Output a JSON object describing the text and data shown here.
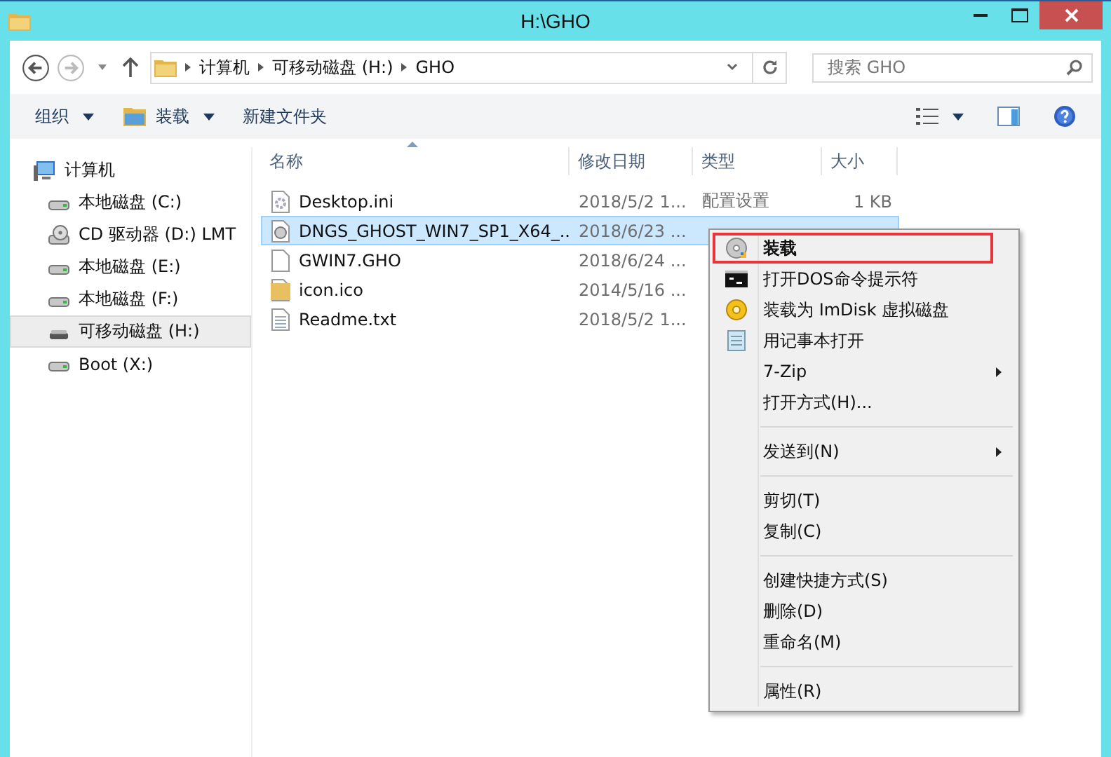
{
  "window": {
    "title": "H:\\GHO"
  },
  "address": {
    "crumbs": [
      "计算机",
      "可移动磁盘 (H:)",
      "GHO"
    ]
  },
  "search": {
    "placeholder": "搜索 GHO"
  },
  "toolbar": {
    "buttons": [
      {
        "label": "组织",
        "dropdown": true
      },
      {
        "label": "装载",
        "dropdown": true
      },
      {
        "label": "新建文件夹",
        "dropdown": false
      }
    ]
  },
  "sidebar": {
    "items": [
      {
        "label": "计算机",
        "kind": "computer",
        "selected": false,
        "children": [
          {
            "label": "本地磁盘 (C:)",
            "kind": "disk",
            "selected": false
          },
          {
            "label": "CD 驱动器 (D:) LMT",
            "kind": "cd",
            "selected": false
          },
          {
            "label": "本地磁盘 (E:)",
            "kind": "disk",
            "selected": false
          },
          {
            "label": "本地磁盘 (F:)",
            "kind": "disk",
            "selected": false
          },
          {
            "label": "可移动磁盘 (H:)",
            "kind": "usb",
            "selected": true
          },
          {
            "label": "Boot (X:)",
            "kind": "disk",
            "selected": false
          }
        ]
      }
    ]
  },
  "table": {
    "columns": [
      "名称",
      "修改日期",
      "类型",
      "大小"
    ],
    "rows": [
      {
        "name": "Desktop.ini",
        "kind": "ini",
        "date": "2018/5/2 1...",
        "type": "配置设置",
        "size": "1 KB",
        "selected": false
      },
      {
        "name": "DNGS_GHOST_WIN7_SP1_X64_...",
        "kind": "iso",
        "date": "2018/6/23 ...",
        "selected": true
      },
      {
        "name": "GWIN7.GHO",
        "kind": "blank",
        "date": "2018/6/24 ...",
        "selected": false
      },
      {
        "name": "icon.ico",
        "kind": "ico",
        "date": "2014/5/16 ...",
        "selected": false
      },
      {
        "name": "Readme.txt",
        "kind": "txt",
        "date": "2018/5/2 1...",
        "selected": false
      }
    ]
  },
  "context_menu": {
    "items": [
      {
        "kind": "item",
        "label": "装载",
        "bold": true,
        "outlined": true,
        "submenu": false
      },
      {
        "kind": "item",
        "label": "打开DOS命令提示符",
        "bold": false,
        "outlined": false,
        "submenu": false
      },
      {
        "kind": "item",
        "label": "装载为 ImDisk 虚拟磁盘",
        "bold": false,
        "outlined": false,
        "submenu": false
      },
      {
        "kind": "item",
        "label": "用记事本打开",
        "bold": false,
        "outlined": false,
        "submenu": false
      },
      {
        "kind": "item",
        "label": "7-Zip",
        "bold": false,
        "outlined": false,
        "submenu": true
      },
      {
        "kind": "item",
        "label": "打开方式(H)...",
        "bold": false,
        "outlined": false,
        "submenu": false
      },
      {
        "kind": "separator"
      },
      {
        "kind": "item",
        "label": "发送到(N)",
        "bold": false,
        "outlined": false,
        "submenu": true
      },
      {
        "kind": "separator"
      },
      {
        "kind": "item",
        "label": "剪切(T)",
        "bold": false,
        "outlined": false,
        "submenu": false
      },
      {
        "kind": "item",
        "label": "复制(C)",
        "bold": false,
        "outlined": false,
        "submenu": false
      },
      {
        "kind": "separator"
      },
      {
        "kind": "item",
        "label": "创建快捷方式(S)",
        "bold": false,
        "outlined": false,
        "submenu": false
      },
      {
        "kind": "item",
        "label": "删除(D)",
        "bold": false,
        "outlined": false,
        "submenu": false
      },
      {
        "kind": "item",
        "label": "重命名(M)",
        "bold": false,
        "outlined": false,
        "submenu": false
      },
      {
        "kind": "separator"
      },
      {
        "kind": "item",
        "label": "属性(R)",
        "bold": false,
        "outlined": false,
        "submenu": false
      }
    ]
  }
}
